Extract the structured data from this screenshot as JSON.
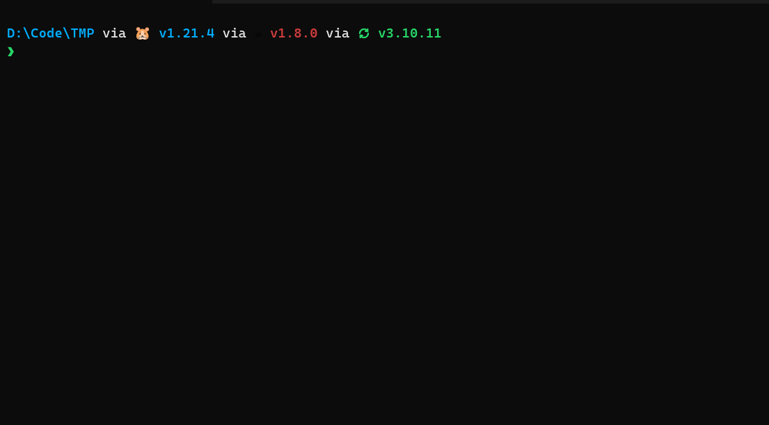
{
  "prompt": {
    "path": "D:\\Code\\TMP",
    "via_label": " via ",
    "go": {
      "icon": "🐹",
      "version": "v1.21.4"
    },
    "java": {
      "icon": "☕",
      "version": "v1.8.0"
    },
    "python": {
      "icon": "refresh",
      "version": "v3.10.11"
    },
    "symbol": "❯"
  },
  "input": {
    "value": ""
  }
}
